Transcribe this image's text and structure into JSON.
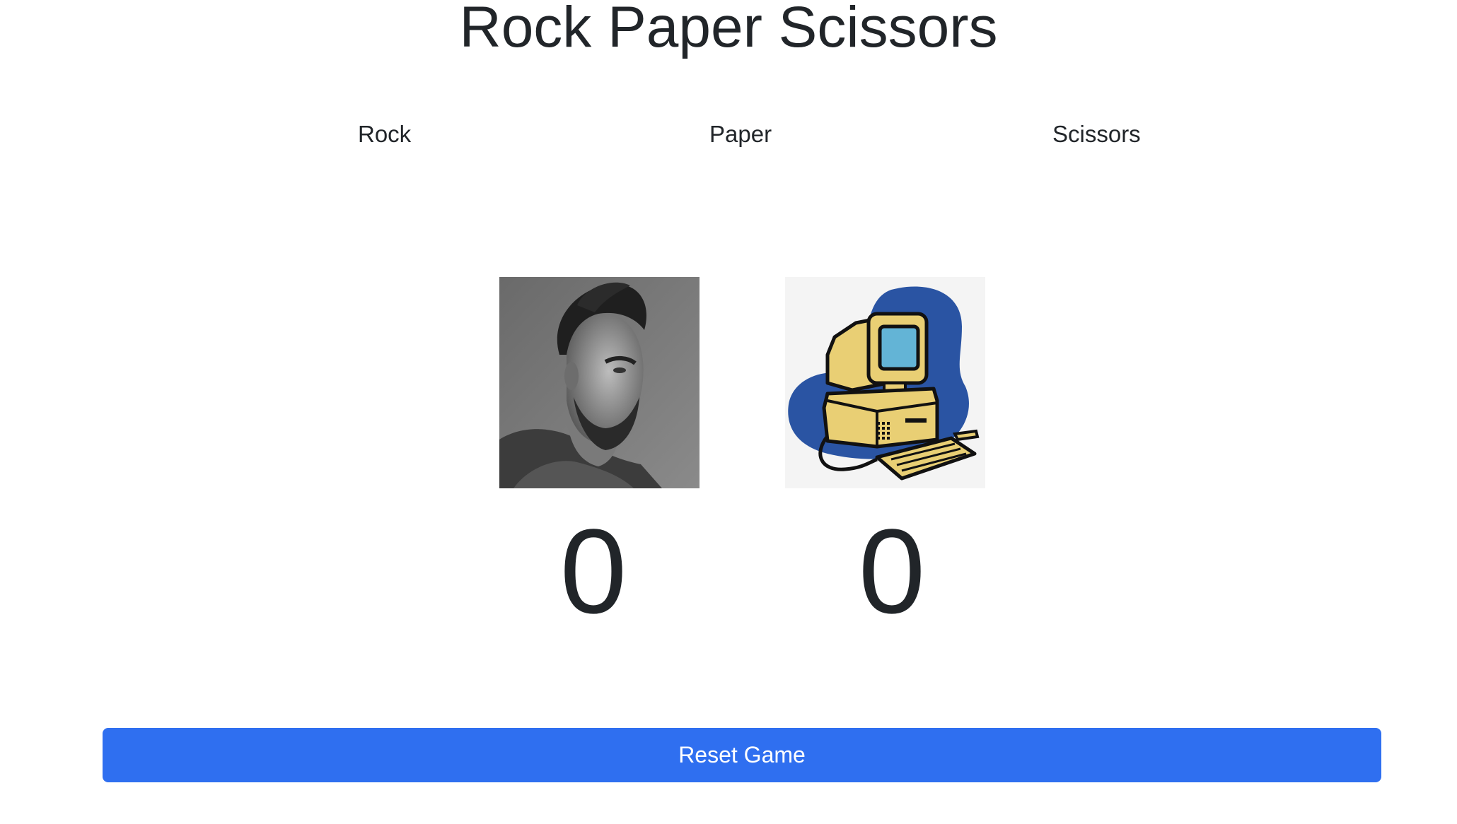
{
  "header": {
    "title": "Rock Paper Scissors"
  },
  "choices": [
    {
      "label": "Rock"
    },
    {
      "label": "Paper"
    },
    {
      "label": "Scissors"
    }
  ],
  "player": {
    "avatar_icon": "man-portrait-photo",
    "score": "0"
  },
  "computer": {
    "avatar_icon": "retro-computer-icon",
    "score": "0"
  },
  "reset": {
    "label": "Reset Game"
  },
  "colors": {
    "button_bg": "#2f6ff0",
    "text": "#212529",
    "computer_blob": "#2a54a3",
    "computer_body": "#e9cf74"
  }
}
